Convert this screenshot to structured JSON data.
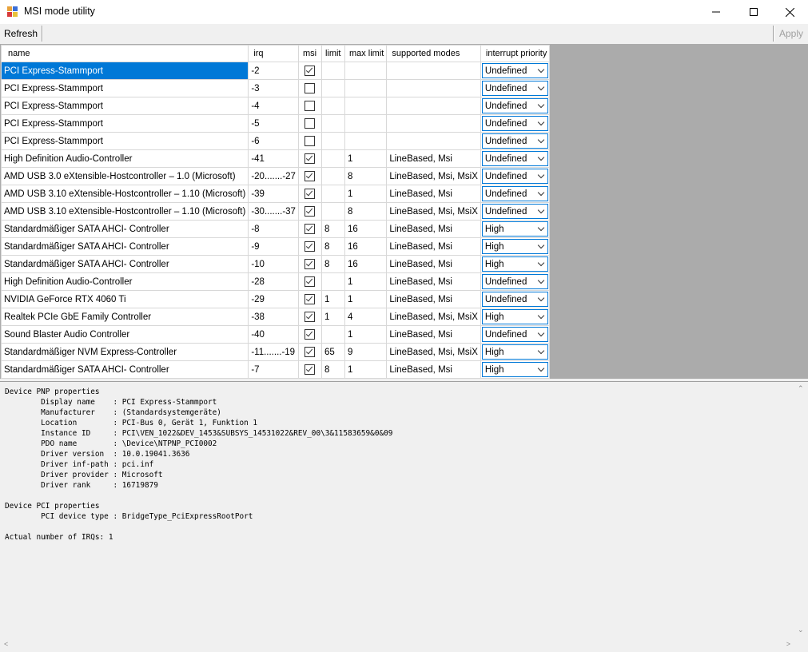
{
  "window": {
    "title": "MSI mode utility",
    "controls": {
      "minimize": "minimize-icon",
      "maximize": "maximize-icon",
      "close": "close-icon"
    }
  },
  "toolbar": {
    "refresh_label": "Refresh",
    "apply_label": "Apply"
  },
  "table": {
    "headers": {
      "name": "name",
      "irq": "irq",
      "msi": "msi",
      "limit": "limit",
      "max_limit": "max limit",
      "supported_modes": "supported modes",
      "interrupt_priority": "interrupt priority"
    },
    "rows": [
      {
        "name": "PCI Express-Stammport",
        "irq": "-2",
        "msi": true,
        "limit": "",
        "max_limit": "",
        "modes": "",
        "priority": "Undefined"
      },
      {
        "name": "PCI Express-Stammport",
        "irq": "-3",
        "msi": false,
        "limit": "",
        "max_limit": "",
        "modes": "",
        "priority": "Undefined"
      },
      {
        "name": "PCI Express-Stammport",
        "irq": "-4",
        "msi": false,
        "limit": "",
        "max_limit": "",
        "modes": "",
        "priority": "Undefined"
      },
      {
        "name": "PCI Express-Stammport",
        "irq": "-5",
        "msi": false,
        "limit": "",
        "max_limit": "",
        "modes": "",
        "priority": "Undefined"
      },
      {
        "name": "PCI Express-Stammport",
        "irq": "-6",
        "msi": false,
        "limit": "",
        "max_limit": "",
        "modes": "",
        "priority": "Undefined"
      },
      {
        "name": "High Definition Audio-Controller",
        "irq": "-41",
        "msi": true,
        "limit": "",
        "max_limit": "1",
        "modes": "LineBased, Msi",
        "priority": "Undefined"
      },
      {
        "name": "AMD USB 3.0 eXtensible-Hostcontroller – 1.0 (Microsoft)",
        "irq": "-20.......-27",
        "msi": true,
        "limit": "",
        "max_limit": "8",
        "modes": "LineBased, Msi, MsiX",
        "priority": "Undefined"
      },
      {
        "name": "AMD USB 3.10 eXtensible-Hostcontroller – 1.10 (Microsoft)",
        "irq": "-39",
        "msi": true,
        "limit": "",
        "max_limit": "1",
        "modes": "LineBased, Msi",
        "priority": "Undefined"
      },
      {
        "name": "AMD USB 3.10 eXtensible-Hostcontroller – 1.10 (Microsoft)",
        "irq": "-30.......-37",
        "msi": true,
        "limit": "",
        "max_limit": "8",
        "modes": "LineBased, Msi, MsiX",
        "priority": "Undefined"
      },
      {
        "name": "Standardmäßiger SATA AHCI- Controller",
        "irq": "-8",
        "msi": true,
        "limit": "8",
        "max_limit": "16",
        "modes": "LineBased, Msi",
        "priority": "High"
      },
      {
        "name": "Standardmäßiger SATA AHCI- Controller",
        "irq": "-9",
        "msi": true,
        "limit": "8",
        "max_limit": "16",
        "modes": "LineBased, Msi",
        "priority": "High"
      },
      {
        "name": "Standardmäßiger SATA AHCI- Controller",
        "irq": "-10",
        "msi": true,
        "limit": "8",
        "max_limit": "16",
        "modes": "LineBased, Msi",
        "priority": "High"
      },
      {
        "name": "High Definition Audio-Controller",
        "irq": "-28",
        "msi": true,
        "limit": "",
        "max_limit": "1",
        "modes": "LineBased, Msi",
        "priority": "Undefined"
      },
      {
        "name": "NVIDIA GeForce RTX 4060 Ti",
        "irq": "-29",
        "msi": true,
        "limit": "1",
        "max_limit": "1",
        "modes": "LineBased, Msi",
        "priority": "Undefined"
      },
      {
        "name": "Realtek PCIe GbE Family Controller",
        "irq": "-38",
        "msi": true,
        "limit": "1",
        "max_limit": "4",
        "modes": "LineBased, Msi, MsiX",
        "priority": "High"
      },
      {
        "name": "Sound Blaster Audio Controller",
        "irq": "-40",
        "msi": true,
        "limit": "",
        "max_limit": "1",
        "modes": "LineBased, Msi",
        "priority": "Undefined"
      },
      {
        "name": "Standardmäßiger NVM Express-Controller",
        "irq": "-11.......-19",
        "msi": true,
        "limit": "65",
        "max_limit": "9",
        "modes": "LineBased, Msi, MsiX",
        "priority": "High"
      },
      {
        "name": "Standardmäßiger SATA AHCI- Controller",
        "irq": "-7",
        "msi": true,
        "limit": "8",
        "max_limit": "1",
        "modes": "LineBased, Msi",
        "priority": "High"
      }
    ]
  },
  "details": {
    "text": "Device PNP properties\n        Display name    : PCI Express-Stammport\n        Manufacturer    : (Standardsystemgeräte)\n        Location        : PCI-Bus 0, Gerät 1, Funktion 1\n        Instance ID     : PCI\\VEN_1022&DEV_1453&SUBSYS_14531022&REV_00\\3&11583659&0&09\n        PDO name        : \\Device\\NTPNP_PCI0002\n        Driver version  : 10.0.19041.3636\n        Driver inf-path : pci.inf\n        Driver provider : Microsoft\n        Driver rank     : 16719879\n\nDevice PCI properties\n        PCI device type : BridgeType_PciExpressRootPort\n\nActual number of IRQs: 1"
  }
}
